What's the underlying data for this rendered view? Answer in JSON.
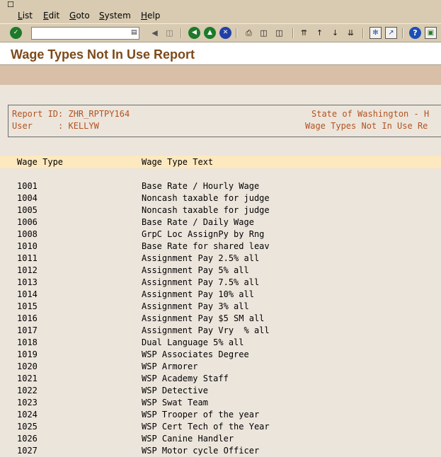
{
  "menu": [
    "List",
    "Edit",
    "Goto",
    "System",
    "Help"
  ],
  "menu_mnemonics": [
    "L",
    "E",
    "G",
    "S",
    "H"
  ],
  "command_field": {
    "value": ""
  },
  "title": "Wage Types Not In Use Report",
  "report_header": {
    "line1_left": "Report ID: ZHR_RPTPY164",
    "line1_right": "State of Washington - H",
    "line2_left": "User     : KELLYW",
    "line2_right": "Wage Types Not In Use Re"
  },
  "columns": [
    "Wage Type",
    "Wage Type Text"
  ],
  "rows": [
    {
      "code": "1001",
      "text": "Base Rate / Hourly Wage"
    },
    {
      "code": "1004",
      "text": "Noncash taxable for judge"
    },
    {
      "code": "1005",
      "text": "Noncash taxable for judge"
    },
    {
      "code": "1006",
      "text": "Base Rate / Daily Wage"
    },
    {
      "code": "1008",
      "text": "GrpC Loc AssignPy by Rng"
    },
    {
      "code": "1010",
      "text": "Base Rate for shared leav"
    },
    {
      "code": "1011",
      "text": "Assignment Pay 2.5% all"
    },
    {
      "code": "1012",
      "text": "Assignment Pay 5% all"
    },
    {
      "code": "1013",
      "text": "Assignment Pay 7.5% all"
    },
    {
      "code": "1014",
      "text": "Assignment Pay 10% all"
    },
    {
      "code": "1015",
      "text": "Assignment Pay 3% all"
    },
    {
      "code": "1016",
      "text": "Assignment Pay $5 SM all"
    },
    {
      "code": "1017",
      "text": "Assignment Pay Vry  % all"
    },
    {
      "code": "1018",
      "text": "Dual Language 5% all"
    },
    {
      "code": "1019",
      "text": "WSP Associates Degree"
    },
    {
      "code": "1020",
      "text": "WSP Armorer"
    },
    {
      "code": "1021",
      "text": "WSP Academy Staff"
    },
    {
      "code": "1022",
      "text": "WSP Detective"
    },
    {
      "code": "1023",
      "text": "WSP Swat Team"
    },
    {
      "code": "1024",
      "text": "WSP Trooper of the year"
    },
    {
      "code": "1025",
      "text": "WSP Cert Tech of the Year"
    },
    {
      "code": "1026",
      "text": "WSP Canine Handler"
    },
    {
      "code": "1027",
      "text": "WSP Motor cycle Officer"
    }
  ],
  "colors": {
    "title": "#7d4a1a",
    "header_text": "#b3531f",
    "column_header_bg": "#fde9c0",
    "background": "#ece5dc"
  }
}
